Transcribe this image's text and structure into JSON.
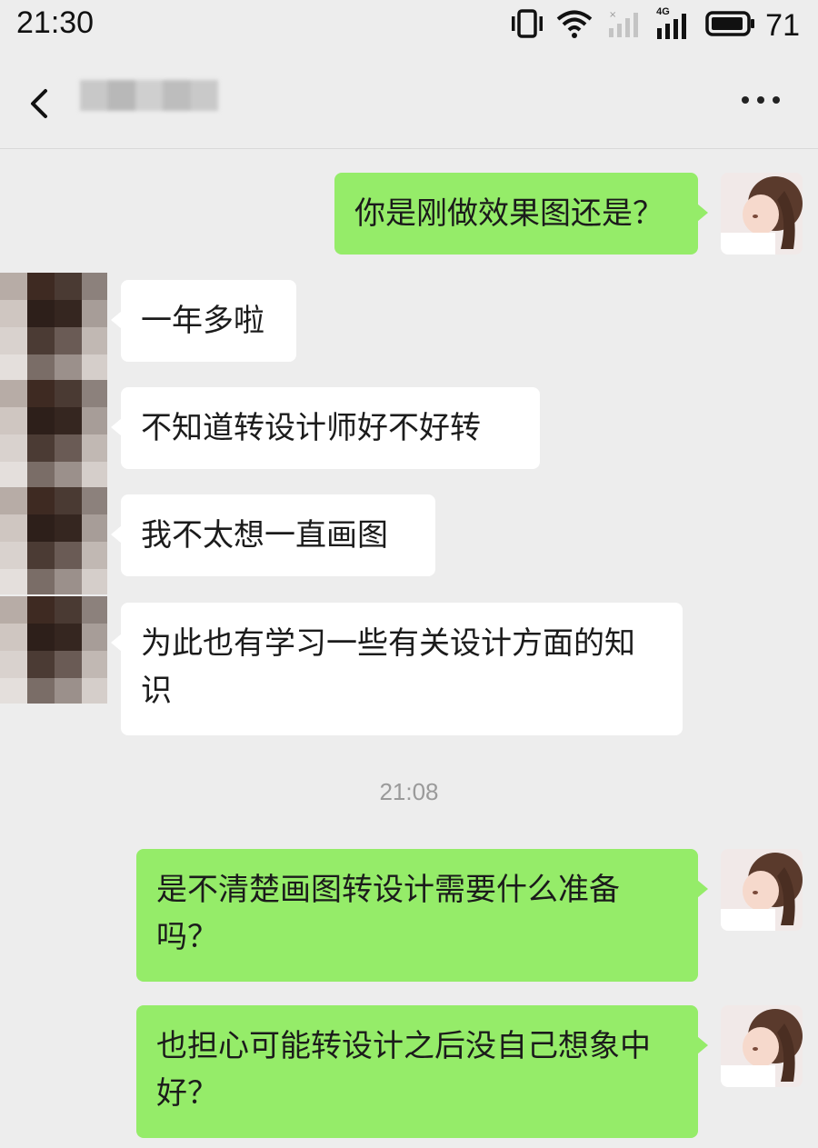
{
  "status_bar": {
    "time": "21:30",
    "battery": "71",
    "network_label": "4G"
  },
  "header": {
    "back_icon": "chevron-left-icon",
    "more_icon": "ellipsis-icon"
  },
  "messages": [
    {
      "side": "out",
      "text": "你是刚做效果图还是？"
    },
    {
      "side": "in",
      "text": "一年多啦"
    },
    {
      "side": "in",
      "text": "不知道转设计师好不好转"
    },
    {
      "side": "in",
      "text": "我不太想一直画图"
    },
    {
      "side": "in",
      "text": "为此也有学习一些有关设计方面的知识"
    },
    {
      "side": "out",
      "text": "是不清楚画图转设计需要什么准备吗？"
    },
    {
      "side": "out",
      "text": "也担心可能转设计之后没自己想象中好？"
    }
  ],
  "time_divider": "21:08",
  "colors": {
    "background": "#ededed",
    "outgoing_bubble": "#95ec69",
    "incoming_bubble": "#ffffff"
  }
}
